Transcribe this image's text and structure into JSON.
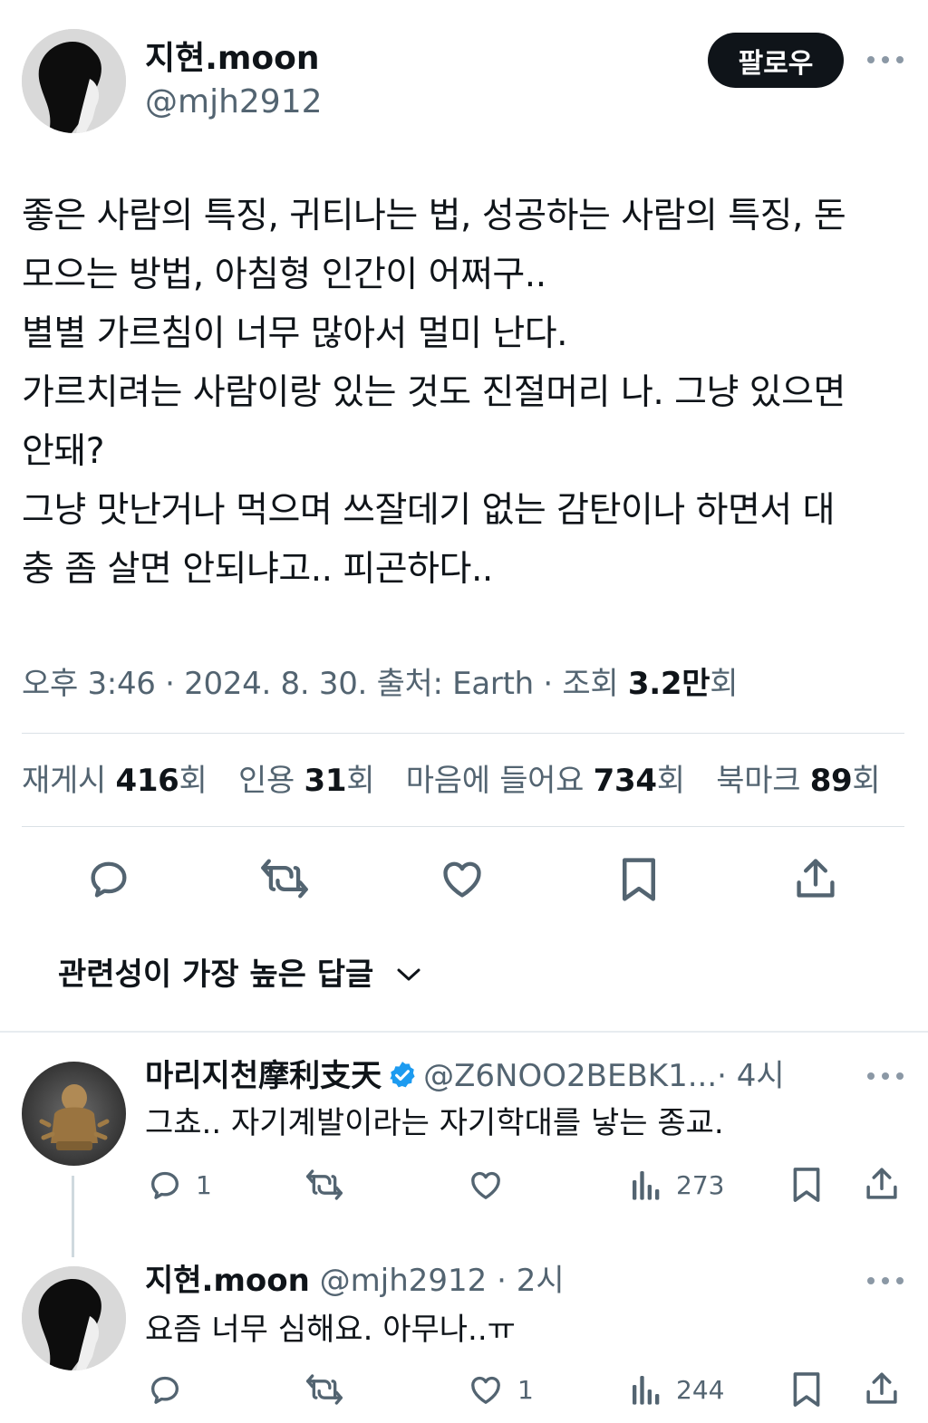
{
  "post": {
    "author_name": "지현.moon",
    "author_handle": "@mjh2912",
    "follow_label": "팔로우",
    "text_lines": [
      "좋은 사람의 특징, 귀티나는 법, 성공하는 사람의 특징, 돈",
      "모으는 방법, 아침형 인간이 어쩌구..",
      "별별 가르침이 너무 많아서 멀미 난다.",
      "가르치려는 사람이랑 있는 것도 진절머리 나. 그냥 있으면",
      "안돼?",
      "그냥 맛난거나 먹으며 쓰잘데기 없는 감탄이나 하면서 대",
      "충 좀 살면 안되냐고.. 피곤하다.."
    ],
    "meta": {
      "time": "오후 3:46",
      "date": "2024. 8. 30.",
      "source": "출처: Earth",
      "views_prefix": "조회",
      "views_value": "3.2만",
      "views_suffix": "회",
      "separator": "·"
    },
    "stats": [
      {
        "label": "재게시",
        "value": "416",
        "suffix": "회"
      },
      {
        "label": "인용",
        "value": "31",
        "suffix": "회"
      },
      {
        "label": "마음에 들어요",
        "value": "734",
        "suffix": "회"
      },
      {
        "label": "북마크",
        "value": "89",
        "suffix": "회"
      }
    ],
    "icons": [
      "reply-icon",
      "repost-icon",
      "like-icon",
      "bookmark-icon",
      "share-icon"
    ]
  },
  "sort": {
    "label": "관련성이 가장 높은 답글",
    "icon": "chevron-down-icon"
  },
  "replies": [
    {
      "name": "마리지천摩利支天",
      "verified": true,
      "handle": "@Z6NOO2BEBK1...",
      "time": "· 4시",
      "text": "그쵸.. 자기계발이라는 자기학대를 낳는 종교.",
      "reply_count": "1",
      "like_count": "",
      "views": "273"
    },
    {
      "name": "지현.moon",
      "verified": false,
      "handle": "@mjh2912",
      "time": "· 2시",
      "text": "요즘 너무 심해요. 아무나..ㅠ",
      "reply_count": "",
      "like_count": "1",
      "views": "244"
    }
  ],
  "colors": {
    "text": "#0f1419",
    "secondary": "#536471",
    "icon": "#536471",
    "verified": "#1d9bf0",
    "divider": "#dbe1e6",
    "follow_bg": "#0f1419"
  }
}
